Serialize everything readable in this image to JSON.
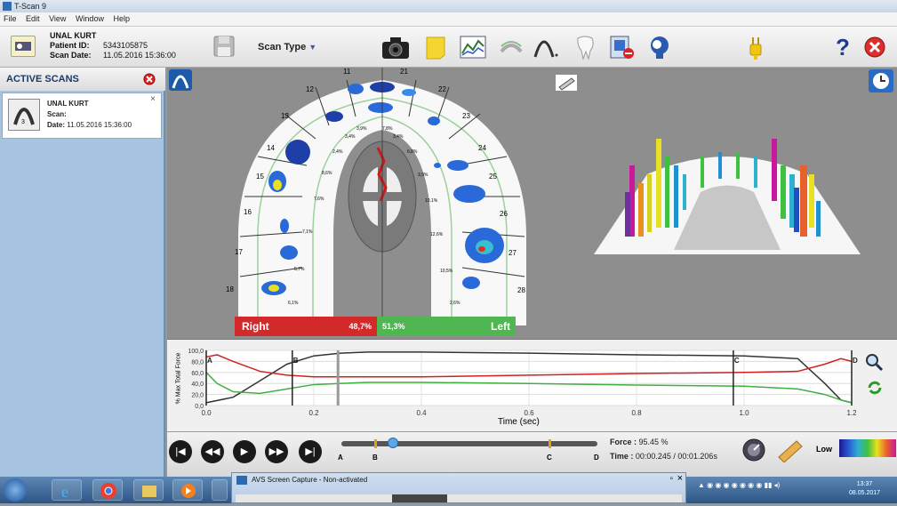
{
  "window": {
    "title": "T-Scan 9"
  },
  "menu": [
    "File",
    "Edit",
    "View",
    "Window",
    "Help"
  ],
  "patient": {
    "name": "UNAL KURT",
    "id_label": "Patient ID:",
    "id": "5343105875",
    "date_label": "Scan Date:",
    "date": "11.05.2016 15:36:00"
  },
  "toolbar": {
    "scan_type": "Scan Type"
  },
  "left_panel": {
    "title": "ACTIVE SCANS",
    "scan": {
      "name": "UNAL KURT",
      "scan_label": "Scan:",
      "date_label": "Date:",
      "date": "11.05.2016 15:36:00",
      "number": "3"
    }
  },
  "arch": {
    "teeth_right": [
      "11",
      "12",
      "13",
      "14",
      "15",
      "16",
      "17",
      "18"
    ],
    "teeth_left": [
      "21",
      "22",
      "23",
      "24",
      "25",
      "26",
      "27",
      "28"
    ],
    "pct_right": [
      "3,9%",
      "3,4%",
      "2,4%",
      "8,6%",
      "7,6%",
      "7,1%",
      "5,7%",
      "6,1%"
    ],
    "pct_left": [
      "7,8%",
      "3,4%",
      "6,8%",
      "3,9%",
      "10,1%",
      "12,6%",
      "10,5%",
      "2,6%"
    ],
    "right_label": "Right",
    "right_value": "48,7%",
    "left_label": "Left",
    "left_value": "51,3%",
    "colors": {
      "right": "#d22a2a",
      "left": "#4fb652"
    }
  },
  "graph": {
    "ylabel": "% Max Total Force",
    "xlabel": "Time (sec)",
    "yticks": [
      "100,0",
      "80,0",
      "60,0",
      "40,0",
      "20,0",
      "0,0"
    ],
    "xticks": [
      "0.0",
      "0.2",
      "0.4",
      "0.6",
      "0.8",
      "1.0",
      "1.2"
    ],
    "markers": [
      "A",
      "B",
      "C",
      "D"
    ]
  },
  "chart_data": {
    "type": "line",
    "xlabel": "Time (sec)",
    "ylabel": "% Max Total Force",
    "xlim": [
      0,
      1.2
    ],
    "ylim": [
      0,
      100
    ],
    "series": [
      {
        "color": "#333333",
        "x": [
          0,
          0.05,
          0.1,
          0.15,
          0.2,
          0.25,
          0.3,
          0.4,
          0.6,
          0.8,
          1.0,
          1.1,
          1.15,
          1.18,
          1.2
        ],
        "y": [
          5,
          15,
          45,
          75,
          90,
          95,
          97,
          97,
          95,
          92,
          90,
          85,
          40,
          10,
          5
        ]
      },
      {
        "color": "#d02020",
        "x": [
          0,
          0.02,
          0.05,
          0.1,
          0.15,
          0.2,
          0.3,
          0.4,
          0.6,
          0.8,
          1.0,
          1.1,
          1.15,
          1.18,
          1.2
        ],
        "y": [
          88,
          92,
          80,
          62,
          55,
          52,
          52,
          52,
          55,
          58,
          60,
          62,
          75,
          85,
          80
        ]
      },
      {
        "color": "#40b040",
        "x": [
          0,
          0.02,
          0.05,
          0.1,
          0.15,
          0.2,
          0.3,
          0.4,
          0.6,
          0.8,
          1.0,
          1.1,
          1.15,
          1.18,
          1.2
        ],
        "y": [
          60,
          40,
          25,
          22,
          30,
          38,
          42,
          42,
          40,
          37,
          35,
          30,
          20,
          10,
          5
        ]
      }
    ],
    "markers": [
      {
        "label": "A",
        "x": 0.0
      },
      {
        "label": "B",
        "x": 0.16
      },
      {
        "label": "C",
        "x": 0.98
      },
      {
        "label": "D",
        "x": 1.2
      }
    ],
    "cursor_x": 0.245
  },
  "playback": {
    "force_label": "Force :",
    "force": "95.45 %",
    "time_label": "Time :",
    "time": "00:00.245 / 00:01.206s",
    "markers": [
      "A",
      "B",
      "C",
      "D"
    ],
    "position": 0.2,
    "low_label": "Low"
  },
  "taskbar": {
    "avs_title": "AVS Screen Capture - Non-activated",
    "clock_time": "13:37",
    "clock_date": "08.05.2017"
  }
}
